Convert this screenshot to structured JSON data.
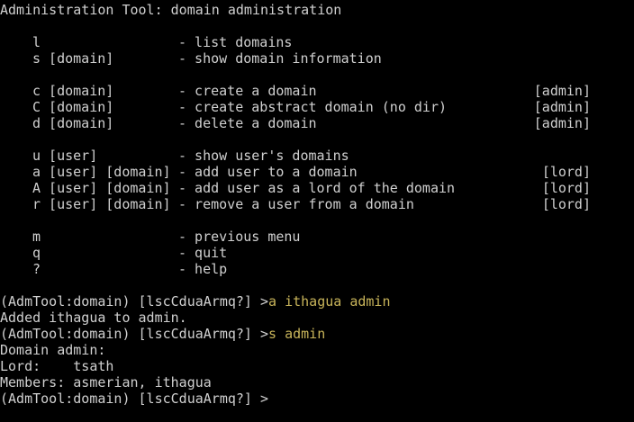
{
  "terminal": {
    "title": "Administration Tool: domain administration",
    "menu": [
      {
        "cmd": "l",
        "desc": "- list domains",
        "perm": ""
      },
      {
        "cmd": "s [domain]",
        "desc": "- show domain information",
        "perm": ""
      },
      null,
      {
        "cmd": "c [domain]",
        "desc": "- create a domain",
        "perm": "[admin]"
      },
      {
        "cmd": "C [domain]",
        "desc": "- create abstract domain (no dir)",
        "perm": "[admin]"
      },
      {
        "cmd": "d [domain]",
        "desc": "- delete a domain",
        "perm": "[admin]"
      },
      null,
      {
        "cmd": "u [user]",
        "desc": "- show user's domains",
        "perm": ""
      },
      {
        "cmd": "a [user] [domain]",
        "desc": "- add user to a domain",
        "perm": "[lord]"
      },
      {
        "cmd": "A [user] [domain]",
        "desc": "- add user as a lord of the domain",
        "perm": "[lord]"
      },
      {
        "cmd": "r [user] [domain]",
        "desc": "- remove a user from a domain",
        "perm": "[lord]"
      },
      null,
      {
        "cmd": "m",
        "desc": "- previous menu",
        "perm": ""
      },
      {
        "cmd": "q",
        "desc": "- quit",
        "perm": ""
      },
      {
        "cmd": "?",
        "desc": "- help",
        "perm": ""
      }
    ],
    "session": [
      {
        "prompt": "(AdmTool:domain) [lscCduaArmq?] >",
        "input": "a ithagua admin"
      },
      {
        "output": "Added ithagua to admin."
      },
      {
        "prompt": "(AdmTool:domain) [lscCduaArmq?] >",
        "input": "s admin"
      },
      {
        "output": "Domain admin:"
      },
      {
        "output": "Lord:    tsath"
      },
      {
        "output": "Members: asmerian, ithagua"
      },
      {
        "prompt": "(AdmTool:domain) [lscCduaArmq?] >",
        "input": ""
      }
    ],
    "colors": {
      "background": "#000000",
      "text": "#d0d0d0",
      "input": "#c8b45a"
    }
  }
}
